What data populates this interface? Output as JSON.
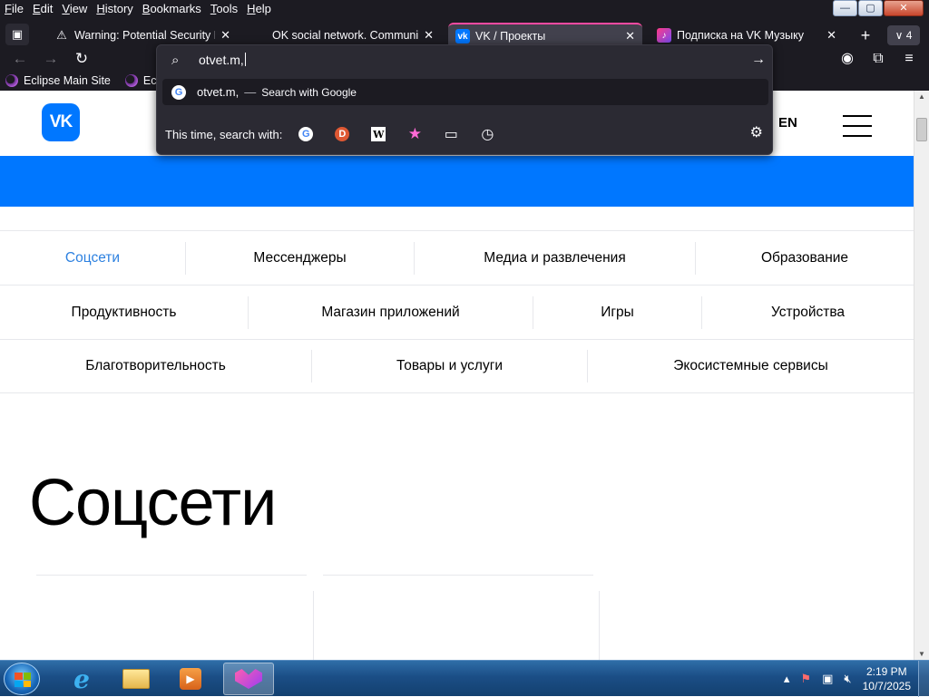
{
  "menubar": {
    "items": [
      "File",
      "Edit",
      "View",
      "History",
      "Bookmarks",
      "Tools",
      "Help"
    ],
    "mnemonics": [
      "F",
      "E",
      "V",
      "H",
      "B",
      "T",
      "H"
    ]
  },
  "window_controls": {
    "minimize": "—",
    "maximize": "▢",
    "close": "✕"
  },
  "tabs": [
    {
      "title": "Warning: Potential Security Risk",
      "favicon": "warning-icon",
      "active": false
    },
    {
      "title": "OK social network. Communicate",
      "favicon": "none",
      "active": false
    },
    {
      "title": "VK / Проекты",
      "favicon": "vk-icon",
      "active": true
    },
    {
      "title": "Подписка на VK Музыку",
      "favicon": "vk-music-icon",
      "active": false
    }
  ],
  "tab_close_glyph": "✕",
  "new_tab_glyph": "+",
  "all_tabs": {
    "glyph": "∨",
    "count": "4"
  },
  "bookmarks": [
    "Eclipse Main Site",
    "Eclips"
  ],
  "urlbar": {
    "value": "otvet.m,",
    "suggestion": {
      "text": "otvet.m,",
      "separator": "—",
      "hint": "Search with Google"
    },
    "engines_label": "This time, search with:",
    "engines": [
      "google-icon",
      "duckduckgo-icon",
      "wikipedia-icon",
      "bookmarks-star-icon",
      "tabs-icon",
      "history-icon"
    ],
    "engine_glyphs": [
      "G",
      "D",
      "W",
      "★",
      "▭",
      "◷"
    ]
  },
  "page": {
    "logo": "VK",
    "lang": "EN",
    "categories": [
      [
        "Соцсети",
        "Мессенджеры",
        "Медиа и развлечения",
        "Образование"
      ],
      [
        "Продуктивность",
        "Магазин приложений",
        "Игры",
        "Устройства"
      ],
      [
        "Благотворительность",
        "Товары и услуги",
        "Экосистемные сервисы"
      ]
    ],
    "selected_category": "Соцсети",
    "heading": "Соцсети"
  },
  "taskbar": {
    "time": "2:19 PM",
    "date": "10/7/2025"
  },
  "colors": {
    "vk_blue": "#0077ff",
    "selected_link": "#2d81e0",
    "browser_dark": "#1c1b22",
    "active_tab_accent": "#ff4aa2"
  }
}
